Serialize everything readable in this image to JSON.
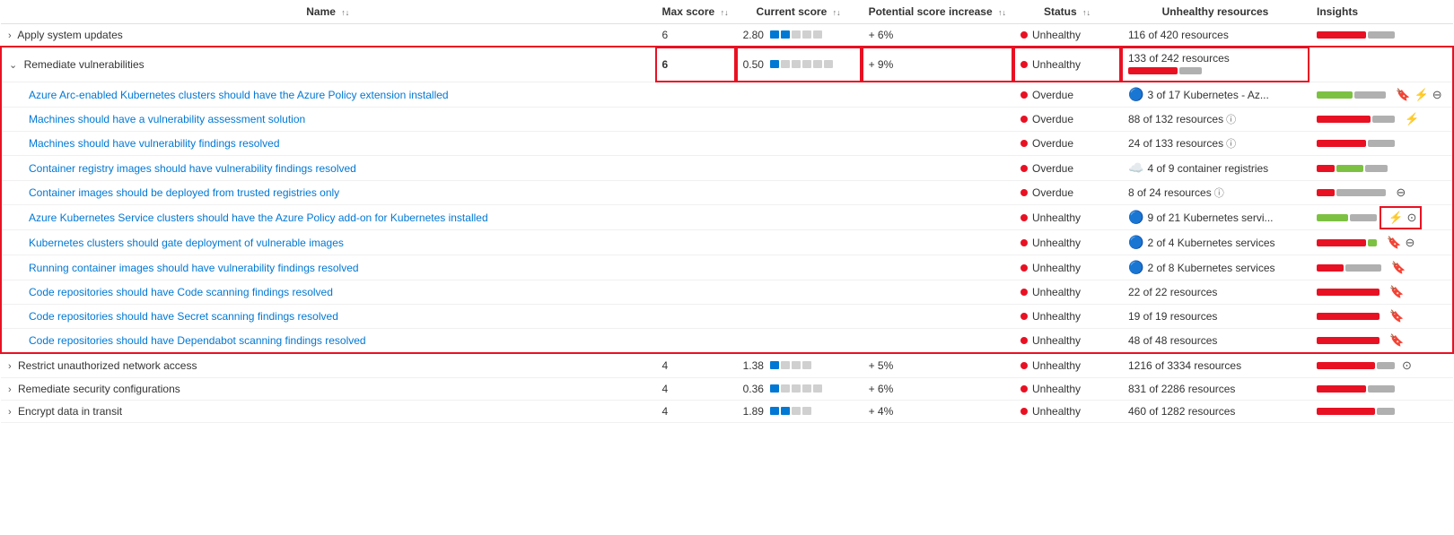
{
  "columns": {
    "name": "Name",
    "maxScore": "Max score",
    "currentScore": "Current score",
    "potentialIncrease": "Potential score increase",
    "status": "Status",
    "unhealthyResources": "Unhealthy resources",
    "insights": "Insights"
  },
  "rows": [
    {
      "id": "apply-system-updates",
      "type": "parent",
      "expanded": false,
      "name": "Apply system updates",
      "maxScore": "6",
      "currentScore": "2.80",
      "currentScoreBars": [
        2,
        5
      ],
      "potentialIncrease": "+ 6%",
      "status": "Unhealthy",
      "unhealthyResources": "116 of 420 resources",
      "insightRed": 55,
      "insightGray": 30,
      "hasIcons": []
    },
    {
      "id": "remediate-vulnerabilities",
      "type": "parent",
      "expanded": true,
      "name": "Remediate vulnerabilities",
      "maxScore": "6",
      "currentScore": "0.50",
      "currentScoreBars": [
        1,
        6
      ],
      "potentialIncrease": "+ 9%",
      "status": "Unhealthy",
      "unhealthyResources": "133 of 242 resources",
      "insightRed": 55,
      "insightGray": 25,
      "hasIcons": [],
      "highlightCells": [
        "maxScore",
        "currentScore",
        "potentialIncrease",
        "status",
        "unhealthyResources"
      ],
      "children": [
        {
          "id": "azure-arc-kubernetes",
          "name": "Azure Arc-enabled Kubernetes clusters should have the Azure Policy extension installed",
          "status": "Overdue",
          "unhealthyResources": "3 of 17 Kubernetes - Az...",
          "insightGreen": 40,
          "insightGray": 35,
          "hasIcons": [
            "bookmark",
            "lightning",
            "circle-minus"
          ]
        },
        {
          "id": "vulnerability-assessment",
          "name": "Machines should have a vulnerability assessment solution",
          "status": "Overdue",
          "unhealthyResources": "88 of 132 resources",
          "hasInfo": true,
          "insightRed": 60,
          "insightGray": 25,
          "hasIcons": [
            "lightning"
          ]
        },
        {
          "id": "vulnerability-findings",
          "name": "Machines should have vulnerability findings resolved",
          "status": "Overdue",
          "unhealthyResources": "24 of 133 resources",
          "hasInfo": true,
          "insightRed": 55,
          "insightGray": 30,
          "hasIcons": []
        },
        {
          "id": "container-registry-images",
          "name": "Container registry images should have vulnerability findings resolved",
          "status": "Overdue",
          "unhealthyResources": "4 of 9 container registries",
          "insightGreen": 30,
          "insightRed": 20,
          "insightGray": 25,
          "hasIcons": []
        },
        {
          "id": "trusted-registries",
          "name": "Container images should be deployed from trusted registries only",
          "status": "Overdue",
          "unhealthyResources": "8 of 24 resources",
          "hasInfo": true,
          "insightRed": 20,
          "insightGray": 55,
          "hasIcons": [
            "circle-minus"
          ]
        },
        {
          "id": "azure-kubernetes-policy",
          "name": "Azure Kubernetes Service clusters should have the Azure Policy add-on for Kubernetes installed",
          "status": "Unhealthy",
          "unhealthyResources": "9 of 21 Kubernetes servi...",
          "insightGreen": 35,
          "insightGray": 30,
          "hasIcons": [
            "lightning",
            "circle-o"
          ],
          "highlightIcons": true
        },
        {
          "id": "kubernetes-gate-deployment",
          "name": "Kubernetes clusters should gate deployment of vulnerable images",
          "status": "Unhealthy",
          "unhealthyResources": "2 of 4 Kubernetes services",
          "insightRed": 55,
          "insightGreen": 10,
          "hasIcons": [
            "bookmark",
            "circle-minus"
          ]
        },
        {
          "id": "running-container-images",
          "name": "Running container images should have vulnerability findings resolved",
          "status": "Unhealthy",
          "unhealthyResources": "2 of 8 Kubernetes services",
          "insightRed": 30,
          "insightGray": 40,
          "hasIcons": [
            "bookmark"
          ]
        },
        {
          "id": "code-repositories-code-scanning",
          "name": "Code repositories should have Code scanning findings resolved",
          "status": "Unhealthy",
          "unhealthyResources": "22 of 22 resources",
          "insightRed": 70,
          "hasIcons": [
            "bookmark"
          ]
        },
        {
          "id": "code-repositories-secret-scanning",
          "name": "Code repositories should have Secret scanning findings resolved",
          "status": "Unhealthy",
          "unhealthyResources": "19 of 19 resources",
          "insightRed": 70,
          "hasIcons": [
            "bookmark"
          ]
        },
        {
          "id": "code-repositories-dependabot",
          "name": "Code repositories should have Dependabot scanning findings resolved",
          "status": "Unhealthy",
          "unhealthyResources": "48 of 48 resources",
          "insightRed": 70,
          "hasIcons": [
            "bookmark"
          ]
        }
      ]
    },
    {
      "id": "restrict-network-access",
      "type": "parent",
      "expanded": false,
      "name": "Restrict unauthorized network access",
      "maxScore": "4",
      "currentScore": "1.38",
      "currentScoreBars": [
        1,
        4
      ],
      "potentialIncrease": "+ 5%",
      "status": "Unhealthy",
      "unhealthyResources": "1216 of 3334 resources",
      "insightRed": 65,
      "insightGray": 20,
      "hasIcons": [
        "circle-o"
      ]
    },
    {
      "id": "remediate-security-configurations",
      "type": "parent",
      "expanded": false,
      "name": "Remediate security configurations",
      "maxScore": "4",
      "currentScore": "0.36",
      "currentScoreBars": [
        1,
        5
      ],
      "potentialIncrease": "+ 6%",
      "status": "Unhealthy",
      "unhealthyResources": "831 of 2286 resources",
      "insightRed": 55,
      "insightGray": 30,
      "hasIcons": []
    },
    {
      "id": "encrypt-data-in-transit",
      "type": "parent",
      "expanded": false,
      "name": "Encrypt data in transit",
      "maxScore": "4",
      "currentScore": "1.89",
      "currentScoreBars": [
        2,
        4
      ],
      "potentialIncrease": "+ 4%",
      "status": "Unhealthy",
      "unhealthyResources": "460 of 1282 resources",
      "insightRed": 65,
      "insightGray": 20,
      "hasIcons": []
    }
  ]
}
